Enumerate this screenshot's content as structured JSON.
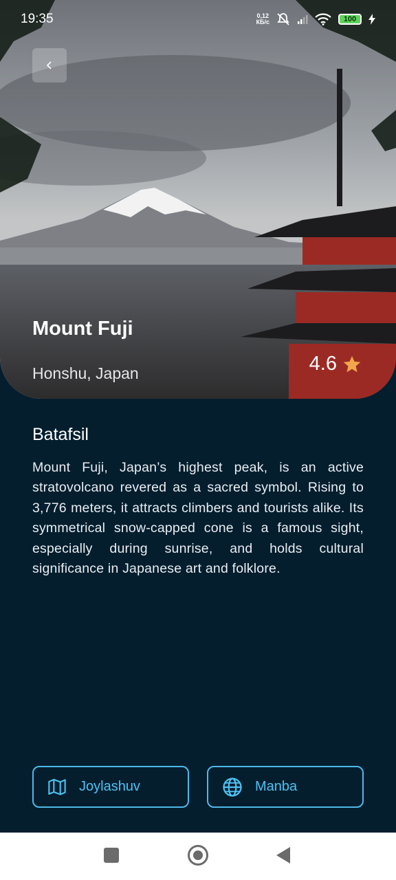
{
  "status_bar": {
    "time": "19:35",
    "net_speed_value": "0,12",
    "net_speed_unit": "КБ/с",
    "battery": "100"
  },
  "place": {
    "title": "Mount Fuji",
    "location": "Honshu, Japan",
    "rating": "4.6"
  },
  "details": {
    "title": "Batafsil",
    "description": "Mount Fuji, Japan’s highest peak, is an active stratovolcano revered as a sacred symbol. Rising to 3,776 meters, it attracts climbers and tourists alike. Its symmetrical snow-capped cone is a famous sight, especially during sunrise, and holds cultural significance in Japanese art and folklore."
  },
  "actions": {
    "map_label": "Joylashuv",
    "source_label": "Manba"
  },
  "colors": {
    "background": "#041e2e",
    "accent": "#4fc1f2",
    "star": "#f0a64a"
  },
  "icons": {
    "back": "chevron-left-icon",
    "star": "star-icon",
    "map": "map-icon",
    "source": "globe-icon"
  }
}
